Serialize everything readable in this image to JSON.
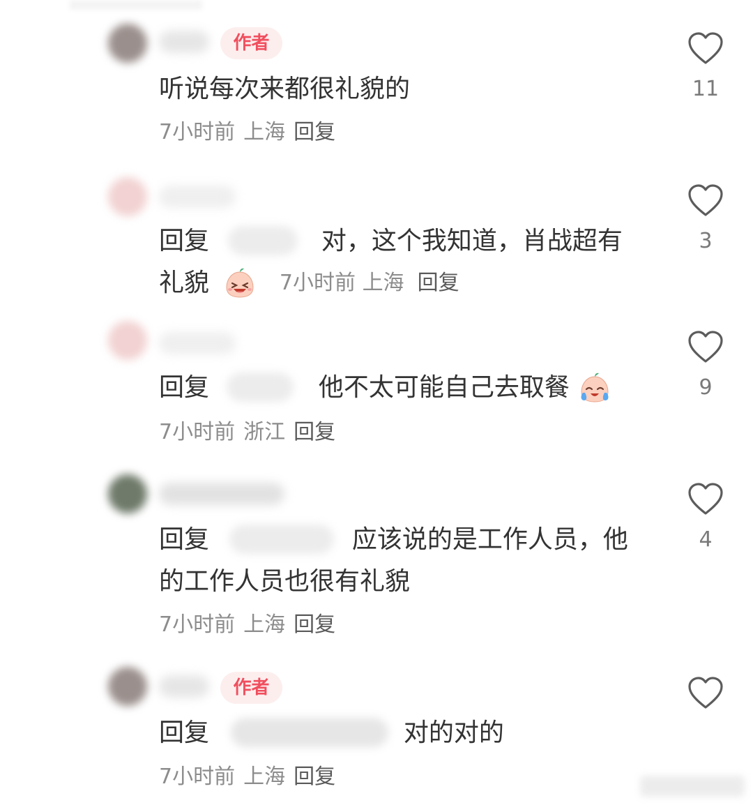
{
  "comments": [
    {
      "author_badge": "作者",
      "text": "听说每次来都很礼貌的",
      "time": "7小时前",
      "location": "上海",
      "reply_label": "回复",
      "likes": "11"
    },
    {
      "reply_prefix": "回复",
      "text_line1": "对，这个我知道，肖战超有",
      "text_line2": "礼貌",
      "emoji": "laughing-emoji",
      "time": "7小时前",
      "location": "上海",
      "reply_label": "回复",
      "likes": "3"
    },
    {
      "reply_prefix": "回复",
      "text": "他不太可能自己去取餐",
      "emoji": "crying-laughing-emoji",
      "time": "7小时前",
      "location": "浙江",
      "reply_label": "回复",
      "likes": "9"
    },
    {
      "reply_prefix": "回复",
      "text_line1": "应该说的是工作人员，他",
      "text_line2": "的工作人员也很有礼貌",
      "time": "7小时前",
      "location": "上海",
      "reply_label": "回复",
      "likes": "4"
    },
    {
      "author_badge": "作者",
      "reply_prefix": "回复",
      "text": "对的对的",
      "time": "7小时前",
      "location": "上海",
      "reply_label": "回复",
      "likes": ""
    }
  ],
  "icons": {
    "like": "heart-outline-icon"
  },
  "colors": {
    "author_badge_bg": "#fdeeee",
    "author_badge_text": "#f04f5e",
    "meta_text": "#8c8c8c",
    "body_text": "#333333"
  }
}
